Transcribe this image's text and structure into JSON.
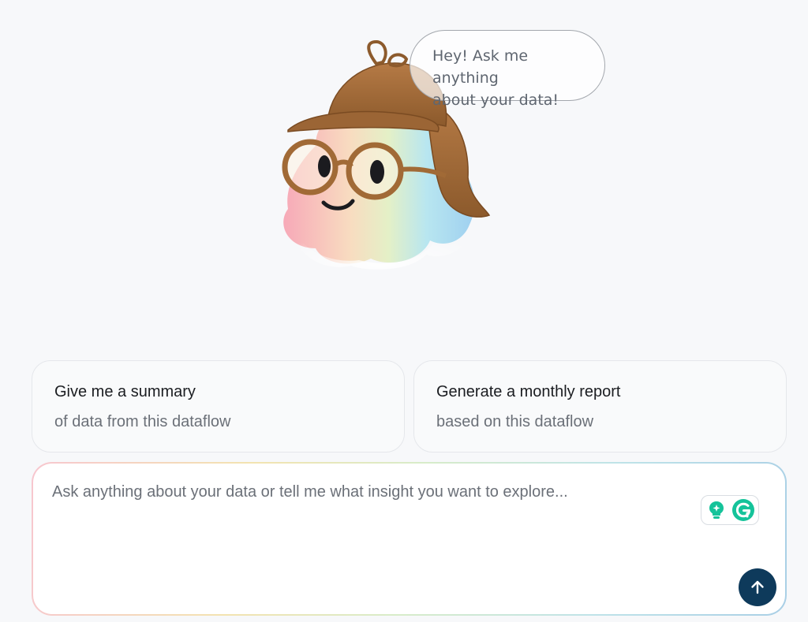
{
  "assistant": {
    "greeting_line1": "Hey! Ask me anything",
    "greeting_line2": "about your data!"
  },
  "suggestions": [
    {
      "title": "Give me a summary",
      "subtitle": "of data from this dataflow"
    },
    {
      "title": "Generate a monthly report",
      "subtitle": "based on this dataflow"
    }
  ],
  "chat_input": {
    "placeholder": "Ask anything about your data or tell me what insight you want to explore...",
    "value": ""
  },
  "icons": {
    "mascot": "detective-ghost-mascot-icon",
    "lightbulb": "lightbulb-sparkle-icon",
    "grammarly": "grammarly-g-icon",
    "send": "arrow-up-icon"
  },
  "colors": {
    "send_button": "#0e3a5b",
    "grammarly": "#15c39a",
    "hat": "#a8703f"
  }
}
